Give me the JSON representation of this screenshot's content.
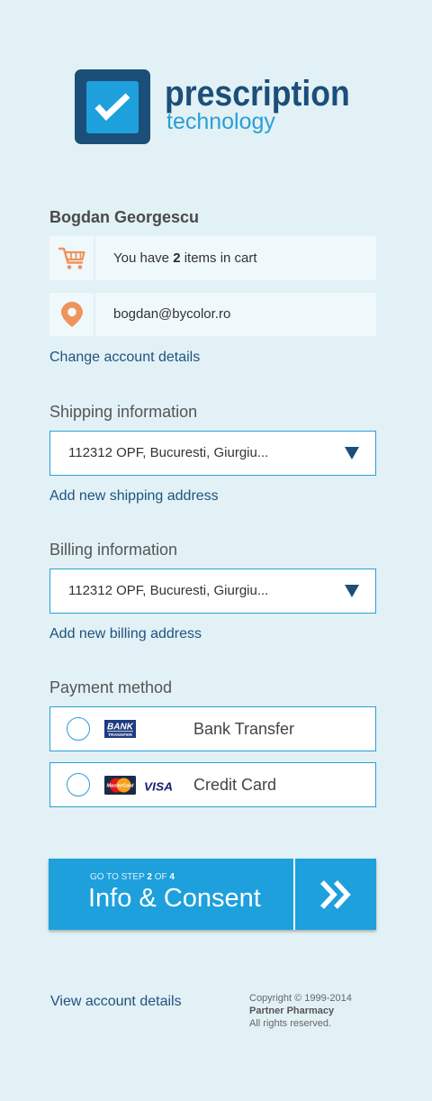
{
  "brand": {
    "line1": "prescription",
    "line2": "technology",
    "logo_icon": "checkbox-check-icon"
  },
  "account": {
    "name": "Bogdan Georgescu",
    "cart": {
      "icon": "shopping-cart-icon",
      "prefix": "You have ",
      "count": "2",
      "suffix": " items in cart"
    },
    "email": {
      "icon": "location-pin-icon",
      "value": "bogdan@bycolor.ro"
    },
    "change_link": "Change account details"
  },
  "shipping": {
    "heading": "Shipping information",
    "selected": "112312 OPF, Bucuresti, Giurgiu...",
    "add_link": "Add new shipping address"
  },
  "billing": {
    "heading": "Billing information",
    "selected": "112312 OPF, Bucuresti, Giurgiu...",
    "add_link": "Add new billing address"
  },
  "payment": {
    "heading": "Payment method",
    "options": [
      {
        "label": "Bank Transfer",
        "selected": false,
        "logos": [
          "bank-transfer-logo"
        ],
        "logo_text": {
          "line1": "BANK",
          "line2": "TRANSFER"
        }
      },
      {
        "label": "Credit Card",
        "selected": false,
        "logos": [
          "mastercard-logo",
          "visa-logo"
        ],
        "logo_text": {
          "mastercard": "MasterCard",
          "visa": "VISA"
        }
      }
    ]
  },
  "next_step": {
    "step_prefix": "GO TO STEP ",
    "step_current": "2",
    "step_sep": " OF ",
    "step_total": "4",
    "label": "Info & Consent",
    "icon": "double-chevron-right-icon"
  },
  "footer": {
    "view_link": "View account details",
    "copyright": "Copyright © 1999-2014",
    "company": "Partner Pharmacy",
    "rights": "All rights reserved."
  },
  "colors": {
    "background": "#e2f1f5",
    "panel": "#eff8fb",
    "accent": "#1ea0dc",
    "navy": "#1b4f7a",
    "orange": "#f0935b",
    "text": "#444444"
  }
}
